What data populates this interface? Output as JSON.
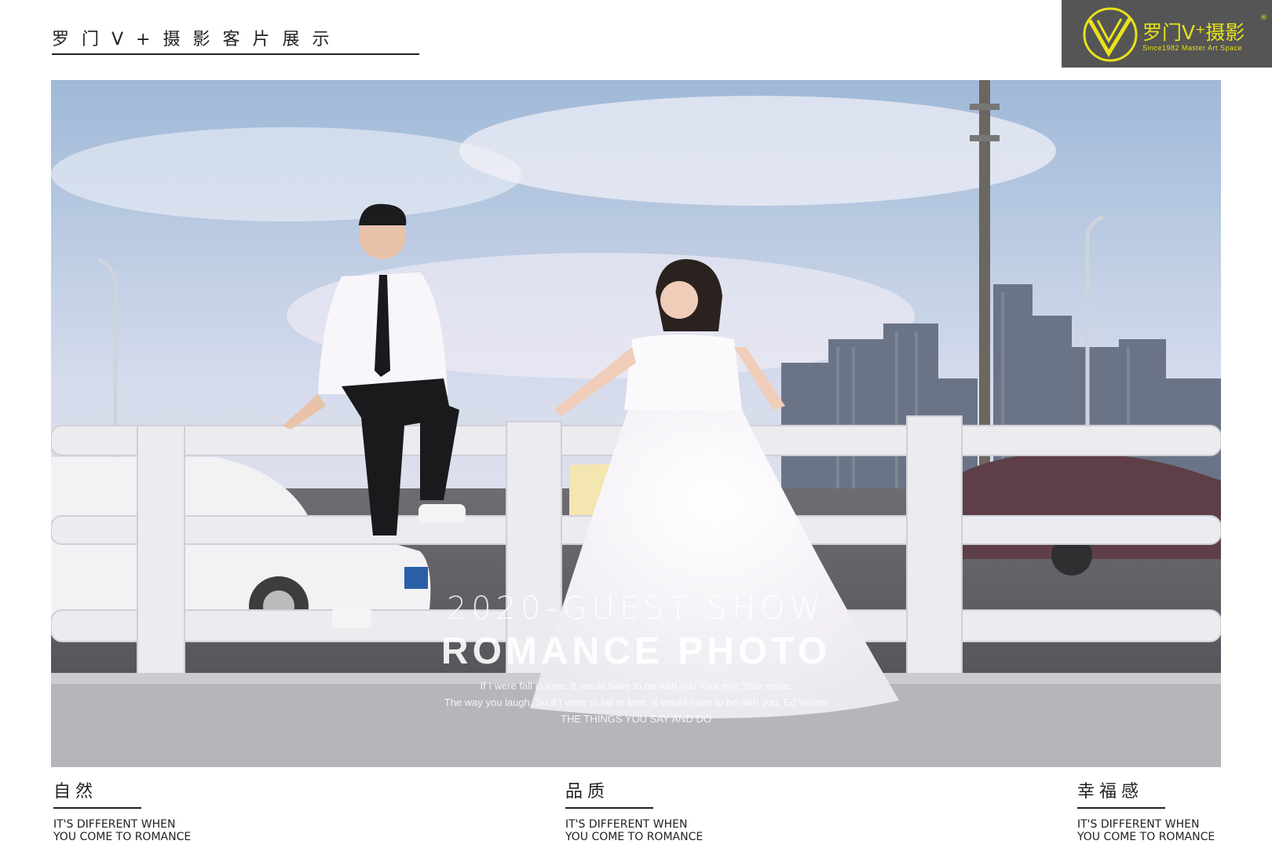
{
  "header": {
    "title": "罗门V+摄影客片展示"
  },
  "logo": {
    "brand": "罗门V⁺摄影",
    "tagline": "Since1982 Master Art Space",
    "reg_mark": "®"
  },
  "overlay": {
    "year_line": "2020-GUEST SHOW",
    "title": "ROMANCE PHOTO",
    "line1": "If I were fall in love. It would have to be with you Your eye.Your smile.",
    "line2": "The way you laugh. So,if I were to fall in love. It would have to be with you. Ed Wslter",
    "line3": "THE THINGS YOU SAY AND DO"
  },
  "captions": [
    {
      "title": "自然",
      "line1": "IT'S DIFFERENT WHEN",
      "line2": "YOU COME TO ROMANCE"
    },
    {
      "title": "品质",
      "line1": "IT'S DIFFERENT WHEN",
      "line2": "YOU COME TO ROMANCE"
    },
    {
      "title": "幸福感",
      "line1": "IT'S DIFFERENT WHEN",
      "line2": "YOU COME TO ROMANCE"
    }
  ],
  "colors": {
    "logo_bg": "#555555",
    "logo_accent": "#e8e21a",
    "text": "#222222"
  }
}
